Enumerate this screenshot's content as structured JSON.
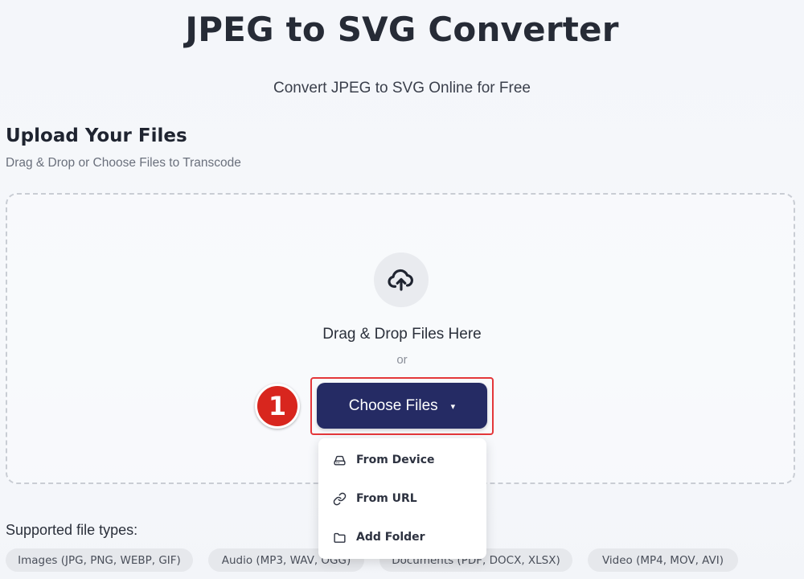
{
  "header": {
    "title": "JPEG to SVG Converter",
    "subtitle": "Convert JPEG to SVG Online for Free"
  },
  "upload": {
    "heading": "Upload Your Files",
    "subheading": "Drag & Drop or Choose Files to Transcode",
    "upload_icon": "cloud-upload-icon",
    "drop_text": "Drag & Drop Files Here",
    "or_text": "or",
    "choose_button": {
      "label": "Choose Files",
      "caret": "▾",
      "color": "#252b64"
    },
    "step_badge": "1",
    "menu": {
      "items": [
        {
          "label": "From Device",
          "icon": "hard-drive-icon"
        },
        {
          "label": "From URL",
          "icon": "link-icon"
        },
        {
          "label": "Add Folder",
          "icon": "folder-icon"
        }
      ]
    }
  },
  "supported": {
    "label": "Supported file types:",
    "chips": [
      "Images (JPG, PNG, WEBP, GIF)",
      "Audio (MP3, WAV, OGG)",
      "Documents (PDF, DOCX, XLSX)",
      "Video (MP4, MOV, AVI)"
    ]
  },
  "colors": {
    "accent": "#252b64",
    "highlight": "#e4373a",
    "badge": "#d8261e"
  }
}
